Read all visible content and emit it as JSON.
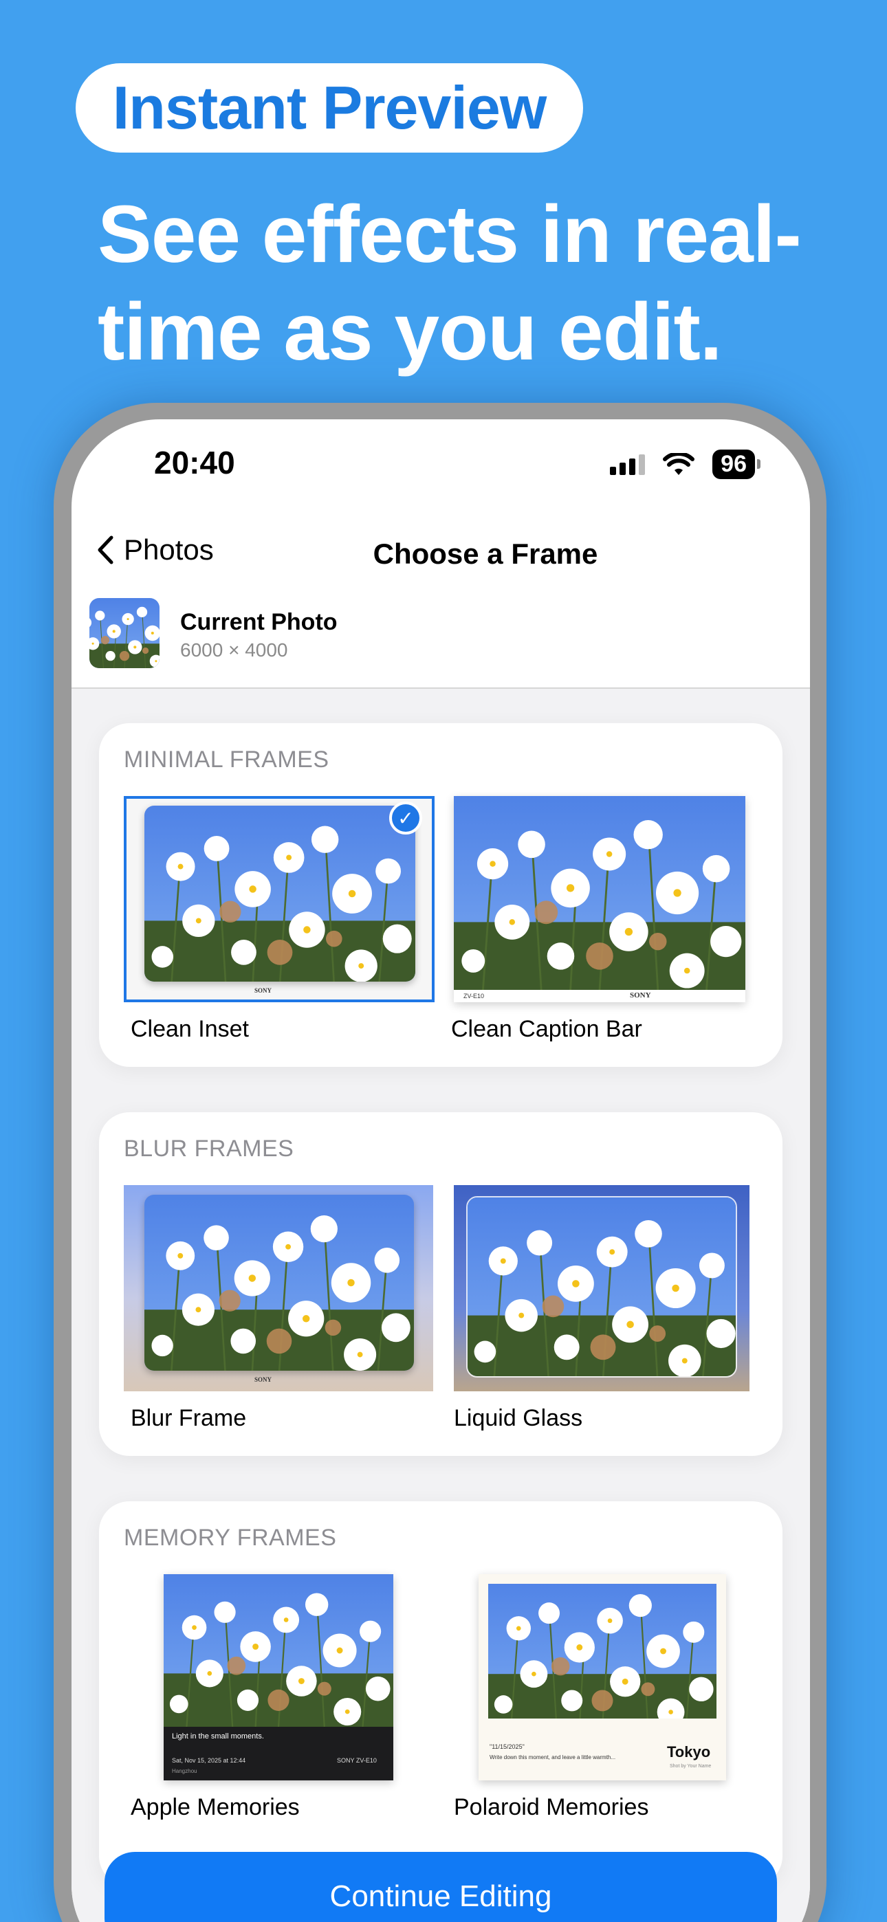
{
  "promo": {
    "badge": "Instant Preview",
    "headline_line1": "See effects in real-",
    "headline_line2": "time as you edit."
  },
  "status": {
    "time": "20:40",
    "battery": "96"
  },
  "nav": {
    "back_label": "Photos",
    "title": "Choose a Frame"
  },
  "current_photo": {
    "title": "Current Photo",
    "dimensions": "6000 × 4000"
  },
  "sections": [
    {
      "title": "MINIMAL FRAMES",
      "items": [
        {
          "label": "Clean Inset",
          "selected": true
        },
        {
          "label": "Clean Caption Bar"
        }
      ]
    },
    {
      "title": "BLUR FRAMES",
      "items": [
        {
          "label": "Blur Frame"
        },
        {
          "label": "Liquid Glass"
        }
      ]
    },
    {
      "title": "MEMORY FRAMES",
      "items": [
        {
          "label": "Apple Memories"
        },
        {
          "label": "Polaroid Memories"
        }
      ]
    }
  ],
  "frame_text": {
    "brand": "SONY",
    "camera_model": "ZV-E10",
    "memories_caption": "Light in the small moments.",
    "memories_date": "Sat, Nov 15, 2025 at 12:44",
    "memories_camera": "SONY ZV-E10",
    "memories_location": "Hangzhou",
    "polaroid_date": "\"11/15/2025\"",
    "polaroid_note": "Write down this moment, and leave a little warmth...",
    "polaroid_city": "Tokyo",
    "polaroid_credit": "Shot by Your Name"
  },
  "button": {
    "label": "Continue Editing"
  },
  "colors": {
    "background": "#41a0ef",
    "accent": "#117af5",
    "badge_text": "#1b7be0"
  }
}
